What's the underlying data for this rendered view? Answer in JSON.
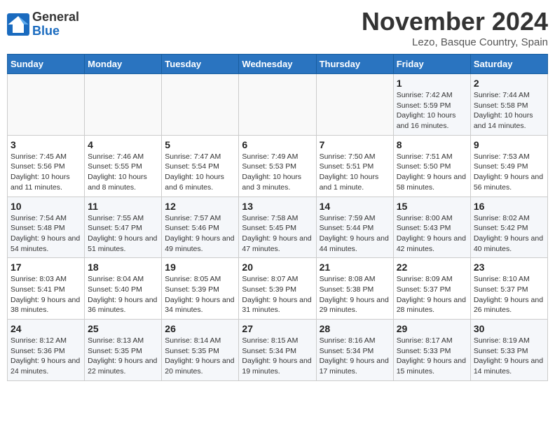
{
  "logo": {
    "general": "General",
    "blue": "Blue"
  },
  "title": "November 2024",
  "location": "Lezo, Basque Country, Spain",
  "weekdays": [
    "Sunday",
    "Monday",
    "Tuesday",
    "Wednesday",
    "Thursday",
    "Friday",
    "Saturday"
  ],
  "weeks": [
    [
      {
        "day": "",
        "info": ""
      },
      {
        "day": "",
        "info": ""
      },
      {
        "day": "",
        "info": ""
      },
      {
        "day": "",
        "info": ""
      },
      {
        "day": "",
        "info": ""
      },
      {
        "day": "1",
        "info": "Sunrise: 7:42 AM\nSunset: 5:59 PM\nDaylight: 10 hours and 16 minutes."
      },
      {
        "day": "2",
        "info": "Sunrise: 7:44 AM\nSunset: 5:58 PM\nDaylight: 10 hours and 14 minutes."
      }
    ],
    [
      {
        "day": "3",
        "info": "Sunrise: 7:45 AM\nSunset: 5:56 PM\nDaylight: 10 hours and 11 minutes."
      },
      {
        "day": "4",
        "info": "Sunrise: 7:46 AM\nSunset: 5:55 PM\nDaylight: 10 hours and 8 minutes."
      },
      {
        "day": "5",
        "info": "Sunrise: 7:47 AM\nSunset: 5:54 PM\nDaylight: 10 hours and 6 minutes."
      },
      {
        "day": "6",
        "info": "Sunrise: 7:49 AM\nSunset: 5:53 PM\nDaylight: 10 hours and 3 minutes."
      },
      {
        "day": "7",
        "info": "Sunrise: 7:50 AM\nSunset: 5:51 PM\nDaylight: 10 hours and 1 minute."
      },
      {
        "day": "8",
        "info": "Sunrise: 7:51 AM\nSunset: 5:50 PM\nDaylight: 9 hours and 58 minutes."
      },
      {
        "day": "9",
        "info": "Sunrise: 7:53 AM\nSunset: 5:49 PM\nDaylight: 9 hours and 56 minutes."
      }
    ],
    [
      {
        "day": "10",
        "info": "Sunrise: 7:54 AM\nSunset: 5:48 PM\nDaylight: 9 hours and 54 minutes."
      },
      {
        "day": "11",
        "info": "Sunrise: 7:55 AM\nSunset: 5:47 PM\nDaylight: 9 hours and 51 minutes."
      },
      {
        "day": "12",
        "info": "Sunrise: 7:57 AM\nSunset: 5:46 PM\nDaylight: 9 hours and 49 minutes."
      },
      {
        "day": "13",
        "info": "Sunrise: 7:58 AM\nSunset: 5:45 PM\nDaylight: 9 hours and 47 minutes."
      },
      {
        "day": "14",
        "info": "Sunrise: 7:59 AM\nSunset: 5:44 PM\nDaylight: 9 hours and 44 minutes."
      },
      {
        "day": "15",
        "info": "Sunrise: 8:00 AM\nSunset: 5:43 PM\nDaylight: 9 hours and 42 minutes."
      },
      {
        "day": "16",
        "info": "Sunrise: 8:02 AM\nSunset: 5:42 PM\nDaylight: 9 hours and 40 minutes."
      }
    ],
    [
      {
        "day": "17",
        "info": "Sunrise: 8:03 AM\nSunset: 5:41 PM\nDaylight: 9 hours and 38 minutes."
      },
      {
        "day": "18",
        "info": "Sunrise: 8:04 AM\nSunset: 5:40 PM\nDaylight: 9 hours and 36 minutes."
      },
      {
        "day": "19",
        "info": "Sunrise: 8:05 AM\nSunset: 5:39 PM\nDaylight: 9 hours and 34 minutes."
      },
      {
        "day": "20",
        "info": "Sunrise: 8:07 AM\nSunset: 5:39 PM\nDaylight: 9 hours and 31 minutes."
      },
      {
        "day": "21",
        "info": "Sunrise: 8:08 AM\nSunset: 5:38 PM\nDaylight: 9 hours and 29 minutes."
      },
      {
        "day": "22",
        "info": "Sunrise: 8:09 AM\nSunset: 5:37 PM\nDaylight: 9 hours and 28 minutes."
      },
      {
        "day": "23",
        "info": "Sunrise: 8:10 AM\nSunset: 5:37 PM\nDaylight: 9 hours and 26 minutes."
      }
    ],
    [
      {
        "day": "24",
        "info": "Sunrise: 8:12 AM\nSunset: 5:36 PM\nDaylight: 9 hours and 24 minutes."
      },
      {
        "day": "25",
        "info": "Sunrise: 8:13 AM\nSunset: 5:35 PM\nDaylight: 9 hours and 22 minutes."
      },
      {
        "day": "26",
        "info": "Sunrise: 8:14 AM\nSunset: 5:35 PM\nDaylight: 9 hours and 20 minutes."
      },
      {
        "day": "27",
        "info": "Sunrise: 8:15 AM\nSunset: 5:34 PM\nDaylight: 9 hours and 19 minutes."
      },
      {
        "day": "28",
        "info": "Sunrise: 8:16 AM\nSunset: 5:34 PM\nDaylight: 9 hours and 17 minutes."
      },
      {
        "day": "29",
        "info": "Sunrise: 8:17 AM\nSunset: 5:33 PM\nDaylight: 9 hours and 15 minutes."
      },
      {
        "day": "30",
        "info": "Sunrise: 8:19 AM\nSunset: 5:33 PM\nDaylight: 9 hours and 14 minutes."
      }
    ]
  ]
}
